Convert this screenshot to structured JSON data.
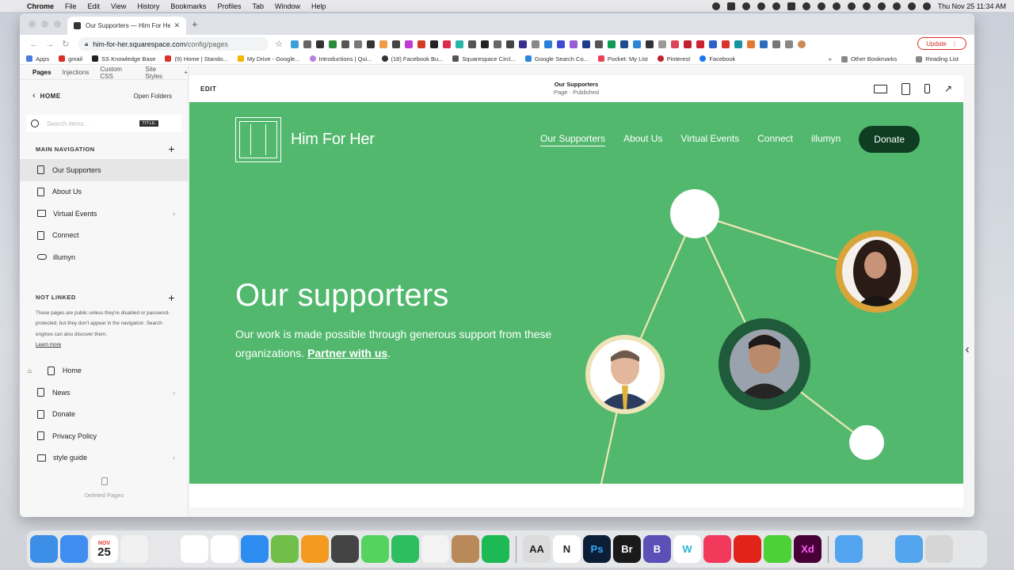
{
  "menubar": {
    "app": "Chrome",
    "items": [
      "File",
      "Edit",
      "View",
      "History",
      "Bookmarks",
      "Profiles",
      "Tab",
      "Window",
      "Help"
    ],
    "clock": "Thu Nov 25  11:34 AM"
  },
  "browser": {
    "tab_title": "Our Supporters — Him For Her",
    "url_host": "him-for-her.squarespace.com",
    "url_path": "/config/pages",
    "update_label": "Update",
    "bookmarks": [
      "Apps",
      "gmail",
      "SS Knowledge Base",
      "(9) Home | Stando...",
      "My Drive - Google...",
      "Introductions | Qui...",
      "(18) Facebook Bu...",
      "Squarespace Circl...",
      "Google Search Co...",
      "Pocket: My List",
      "Pinterest",
      "Facebook"
    ],
    "bookmarks_more": "»",
    "other_bookmarks": "Other Bookmarks",
    "reading_list": "Reading List"
  },
  "sidebar": {
    "tabs": [
      "Pages",
      "Injections",
      "Custom CSS",
      "Site Styles",
      "+"
    ],
    "home_label": "HOME",
    "open_folders": "Open Folders",
    "search_placeholder": "Search items...",
    "search_badge": "TITLE",
    "main_nav_label": "MAIN NAVIGATION",
    "main_nav": [
      {
        "label": "Our Supporters",
        "icon": "page-icon"
      },
      {
        "label": "About Us",
        "icon": "page-icon"
      },
      {
        "label": "Virtual Events",
        "icon": "folder-icon"
      },
      {
        "label": "Connect",
        "icon": "page-icon"
      },
      {
        "label": "illumyn",
        "icon": "link-icon"
      }
    ],
    "not_linked_label": "NOT LINKED",
    "not_linked_note": "These pages are public unless they're disabled or password-protected, but they don't appear in the navigation. Search engines can also discover them.",
    "learn_more": "Learn more",
    "not_linked": [
      {
        "label": "Home",
        "icon": "page-icon"
      },
      {
        "label": "News",
        "icon": "blog-icon"
      },
      {
        "label": "Donate",
        "icon": "page-icon"
      },
      {
        "label": "Privacy Policy",
        "icon": "page-icon"
      },
      {
        "label": "style guide",
        "icon": "folder-icon"
      }
    ],
    "deleted_pages": "Deleted Pages"
  },
  "preview": {
    "edit_label": "EDIT",
    "page_name": "Our Supporters",
    "page_status": "Page · Published"
  },
  "site": {
    "brand": "Him For Her",
    "nav": [
      "Our Supporters",
      "About Us",
      "Virtual Events",
      "Connect",
      "illumyn"
    ],
    "donate": "Donate",
    "hero_title": "Our supporters",
    "hero_sub_text": "Our work is made possible through generous support from these organizations.",
    "hero_sub_link": "Partner with us",
    "hero_sub_end": "."
  },
  "colors": {
    "site_green": "#52b86d",
    "donate_dark": "#0e3d22",
    "ring_gold": "#d9a43a",
    "ring_dark": "#1f5a3a",
    "ring_cream": "#efe3b8"
  },
  "dock": [
    {
      "name": "finder",
      "color": "#3d8ee6"
    },
    {
      "name": "mail",
      "color": "#3f8df0"
    },
    {
      "name": "calendar",
      "color": "#ffffff",
      "text": "25",
      "month": "NOV"
    },
    {
      "name": "chrome",
      "color": "#f1f1f1"
    },
    {
      "name": "launchpad",
      "color": "#e7e7ea"
    },
    {
      "name": "slack",
      "color": "#ffffff"
    },
    {
      "name": "photos",
      "color": "#ffffff"
    },
    {
      "name": "app-store",
      "color": "#2d8cf0"
    },
    {
      "name": "keka",
      "color": "#6fbf48"
    },
    {
      "name": "pages",
      "color": "#f39a1f"
    },
    {
      "name": "printer",
      "color": "#444444"
    },
    {
      "name": "messages",
      "color": "#54d35e"
    },
    {
      "name": "evernote",
      "color": "#2dbe60"
    },
    {
      "name": "textedit",
      "color": "#f3f3f3"
    },
    {
      "name": "contacts",
      "color": "#b9895a"
    },
    {
      "name": "spotify",
      "color": "#1db954"
    },
    {
      "name": "font-book",
      "color": "#dcdcdc",
      "text": "AA"
    },
    {
      "name": "notion",
      "color": "#ffffff",
      "text": "N"
    },
    {
      "name": "photoshop",
      "color": "#0b1e36",
      "text": "Ps"
    },
    {
      "name": "bridge",
      "color": "#1a1a1a",
      "text": "Br"
    },
    {
      "name": "bbedit",
      "color": "#5c4fb5",
      "text": "B"
    },
    {
      "name": "webflow",
      "color": "#ffffff",
      "text": "W"
    },
    {
      "name": "music",
      "color": "#f2395c"
    },
    {
      "name": "acrobat",
      "color": "#e2231a"
    },
    {
      "name": "battery-app",
      "color": "#4cd137"
    },
    {
      "name": "xd",
      "color": "#470137",
      "text": "Xd"
    },
    {
      "name": "applications-folder",
      "color": "#53a5f0"
    },
    {
      "name": "downloads-stack",
      "color": "#e8e8e8"
    },
    {
      "name": "documents-folder",
      "color": "#53a5f0"
    },
    {
      "name": "trash",
      "color": "#d6d6d6"
    }
  ]
}
